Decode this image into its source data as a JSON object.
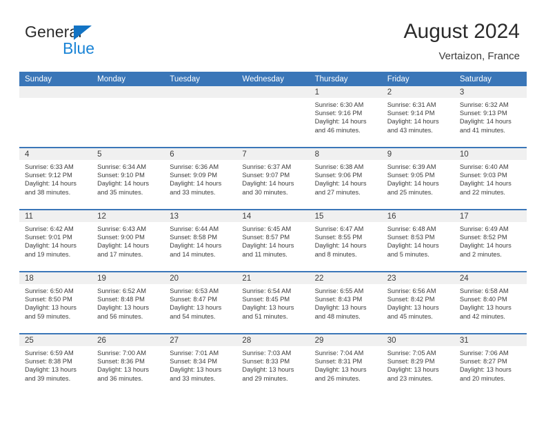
{
  "brand": {
    "line1": "General",
    "line2": "Blue",
    "triangle_icon": "brand-triangle-icon",
    "accent_color": "#1a84d6"
  },
  "header": {
    "title": "August 2024",
    "subtitle": "Vertaizon, France"
  },
  "theme": {
    "header_blue": "#3a76b8",
    "daynum_band": "#f0f0f0",
    "text": "#3b3b3b"
  },
  "calendar": {
    "day_headers": [
      "Sunday",
      "Monday",
      "Tuesday",
      "Wednesday",
      "Thursday",
      "Friday",
      "Saturday"
    ],
    "labels": {
      "sunrise": "Sunrise:",
      "sunset": "Sunset:",
      "daylight": "Daylight:"
    },
    "weeks": [
      [
        {
          "day": "",
          "empty": true
        },
        {
          "day": "",
          "empty": true
        },
        {
          "day": "",
          "empty": true
        },
        {
          "day": "",
          "empty": true
        },
        {
          "day": "1",
          "sunrise": "Sunrise: 6:30 AM",
          "sunset": "Sunset: 9:16 PM",
          "daylight_1": "Daylight: 14 hours",
          "daylight_2": "and 46 minutes."
        },
        {
          "day": "2",
          "sunrise": "Sunrise: 6:31 AM",
          "sunset": "Sunset: 9:14 PM",
          "daylight_1": "Daylight: 14 hours",
          "daylight_2": "and 43 minutes."
        },
        {
          "day": "3",
          "sunrise": "Sunrise: 6:32 AM",
          "sunset": "Sunset: 9:13 PM",
          "daylight_1": "Daylight: 14 hours",
          "daylight_2": "and 41 minutes."
        }
      ],
      [
        {
          "day": "4",
          "sunrise": "Sunrise: 6:33 AM",
          "sunset": "Sunset: 9:12 PM",
          "daylight_1": "Daylight: 14 hours",
          "daylight_2": "and 38 minutes."
        },
        {
          "day": "5",
          "sunrise": "Sunrise: 6:34 AM",
          "sunset": "Sunset: 9:10 PM",
          "daylight_1": "Daylight: 14 hours",
          "daylight_2": "and 35 minutes."
        },
        {
          "day": "6",
          "sunrise": "Sunrise: 6:36 AM",
          "sunset": "Sunset: 9:09 PM",
          "daylight_1": "Daylight: 14 hours",
          "daylight_2": "and 33 minutes."
        },
        {
          "day": "7",
          "sunrise": "Sunrise: 6:37 AM",
          "sunset": "Sunset: 9:07 PM",
          "daylight_1": "Daylight: 14 hours",
          "daylight_2": "and 30 minutes."
        },
        {
          "day": "8",
          "sunrise": "Sunrise: 6:38 AM",
          "sunset": "Sunset: 9:06 PM",
          "daylight_1": "Daylight: 14 hours",
          "daylight_2": "and 27 minutes."
        },
        {
          "day": "9",
          "sunrise": "Sunrise: 6:39 AM",
          "sunset": "Sunset: 9:05 PM",
          "daylight_1": "Daylight: 14 hours",
          "daylight_2": "and 25 minutes."
        },
        {
          "day": "10",
          "sunrise": "Sunrise: 6:40 AM",
          "sunset": "Sunset: 9:03 PM",
          "daylight_1": "Daylight: 14 hours",
          "daylight_2": "and 22 minutes."
        }
      ],
      [
        {
          "day": "11",
          "sunrise": "Sunrise: 6:42 AM",
          "sunset": "Sunset: 9:01 PM",
          "daylight_1": "Daylight: 14 hours",
          "daylight_2": "and 19 minutes."
        },
        {
          "day": "12",
          "sunrise": "Sunrise: 6:43 AM",
          "sunset": "Sunset: 9:00 PM",
          "daylight_1": "Daylight: 14 hours",
          "daylight_2": "and 17 minutes."
        },
        {
          "day": "13",
          "sunrise": "Sunrise: 6:44 AM",
          "sunset": "Sunset: 8:58 PM",
          "daylight_1": "Daylight: 14 hours",
          "daylight_2": "and 14 minutes."
        },
        {
          "day": "14",
          "sunrise": "Sunrise: 6:45 AM",
          "sunset": "Sunset: 8:57 PM",
          "daylight_1": "Daylight: 14 hours",
          "daylight_2": "and 11 minutes."
        },
        {
          "day": "15",
          "sunrise": "Sunrise: 6:47 AM",
          "sunset": "Sunset: 8:55 PM",
          "daylight_1": "Daylight: 14 hours",
          "daylight_2": "and 8 minutes."
        },
        {
          "day": "16",
          "sunrise": "Sunrise: 6:48 AM",
          "sunset": "Sunset: 8:53 PM",
          "daylight_1": "Daylight: 14 hours",
          "daylight_2": "and 5 minutes."
        },
        {
          "day": "17",
          "sunrise": "Sunrise: 6:49 AM",
          "sunset": "Sunset: 8:52 PM",
          "daylight_1": "Daylight: 14 hours",
          "daylight_2": "and 2 minutes."
        }
      ],
      [
        {
          "day": "18",
          "sunrise": "Sunrise: 6:50 AM",
          "sunset": "Sunset: 8:50 PM",
          "daylight_1": "Daylight: 13 hours",
          "daylight_2": "and 59 minutes."
        },
        {
          "day": "19",
          "sunrise": "Sunrise: 6:52 AM",
          "sunset": "Sunset: 8:48 PM",
          "daylight_1": "Daylight: 13 hours",
          "daylight_2": "and 56 minutes."
        },
        {
          "day": "20",
          "sunrise": "Sunrise: 6:53 AM",
          "sunset": "Sunset: 8:47 PM",
          "daylight_1": "Daylight: 13 hours",
          "daylight_2": "and 54 minutes."
        },
        {
          "day": "21",
          "sunrise": "Sunrise: 6:54 AM",
          "sunset": "Sunset: 8:45 PM",
          "daylight_1": "Daylight: 13 hours",
          "daylight_2": "and 51 minutes."
        },
        {
          "day": "22",
          "sunrise": "Sunrise: 6:55 AM",
          "sunset": "Sunset: 8:43 PM",
          "daylight_1": "Daylight: 13 hours",
          "daylight_2": "and 48 minutes."
        },
        {
          "day": "23",
          "sunrise": "Sunrise: 6:56 AM",
          "sunset": "Sunset: 8:42 PM",
          "daylight_1": "Daylight: 13 hours",
          "daylight_2": "and 45 minutes."
        },
        {
          "day": "24",
          "sunrise": "Sunrise: 6:58 AM",
          "sunset": "Sunset: 8:40 PM",
          "daylight_1": "Daylight: 13 hours",
          "daylight_2": "and 42 minutes."
        }
      ],
      [
        {
          "day": "25",
          "sunrise": "Sunrise: 6:59 AM",
          "sunset": "Sunset: 8:38 PM",
          "daylight_1": "Daylight: 13 hours",
          "daylight_2": "and 39 minutes."
        },
        {
          "day": "26",
          "sunrise": "Sunrise: 7:00 AM",
          "sunset": "Sunset: 8:36 PM",
          "daylight_1": "Daylight: 13 hours",
          "daylight_2": "and 36 minutes."
        },
        {
          "day": "27",
          "sunrise": "Sunrise: 7:01 AM",
          "sunset": "Sunset: 8:34 PM",
          "daylight_1": "Daylight: 13 hours",
          "daylight_2": "and 33 minutes."
        },
        {
          "day": "28",
          "sunrise": "Sunrise: 7:03 AM",
          "sunset": "Sunset: 8:33 PM",
          "daylight_1": "Daylight: 13 hours",
          "daylight_2": "and 29 minutes."
        },
        {
          "day": "29",
          "sunrise": "Sunrise: 7:04 AM",
          "sunset": "Sunset: 8:31 PM",
          "daylight_1": "Daylight: 13 hours",
          "daylight_2": "and 26 minutes."
        },
        {
          "day": "30",
          "sunrise": "Sunrise: 7:05 AM",
          "sunset": "Sunset: 8:29 PM",
          "daylight_1": "Daylight: 13 hours",
          "daylight_2": "and 23 minutes."
        },
        {
          "day": "31",
          "sunrise": "Sunrise: 7:06 AM",
          "sunset": "Sunset: 8:27 PM",
          "daylight_1": "Daylight: 13 hours",
          "daylight_2": "and 20 minutes."
        }
      ]
    ]
  }
}
